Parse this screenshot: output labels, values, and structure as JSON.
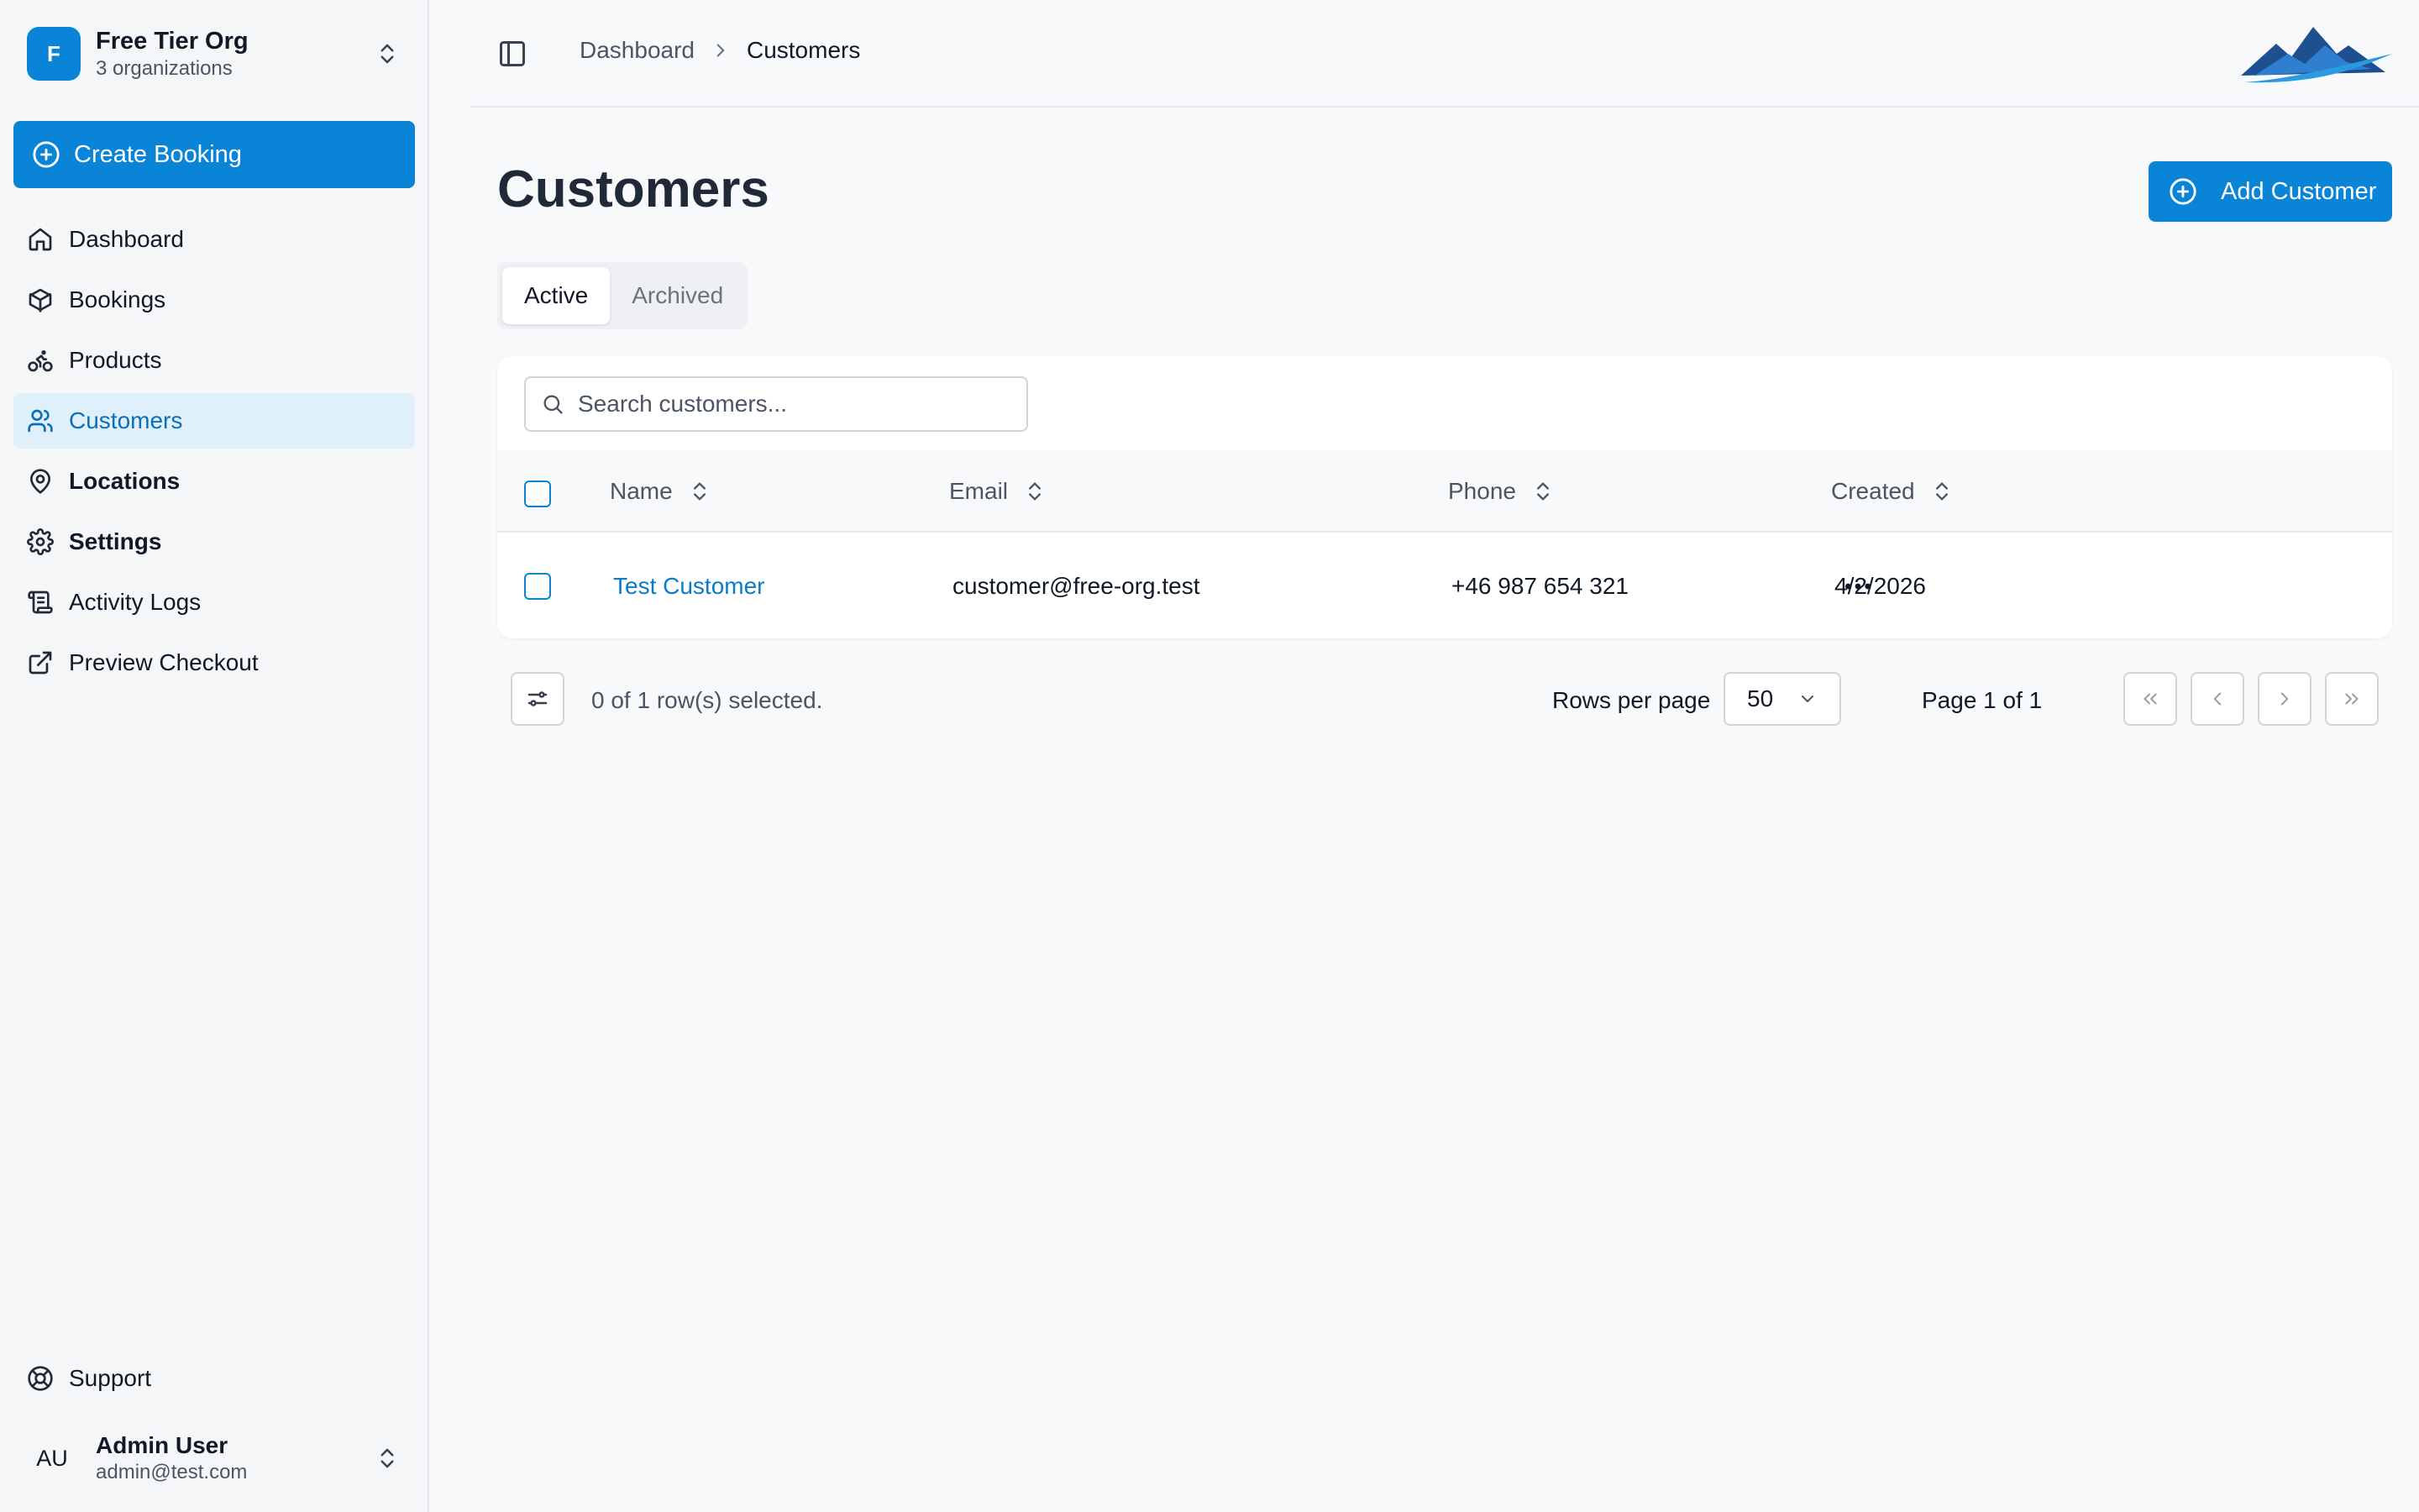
{
  "org": {
    "initial": "F",
    "name": "Free Tier Org",
    "subtitle": "3 organizations"
  },
  "sidebar": {
    "create_label": "Create Booking",
    "items": [
      {
        "label": "Dashboard",
        "icon": "home-icon"
      },
      {
        "label": "Bookings",
        "icon": "box-icon"
      },
      {
        "label": "Products",
        "icon": "bike-icon"
      },
      {
        "label": "Customers",
        "icon": "users-icon",
        "active": true
      },
      {
        "label": "Locations",
        "icon": "map-pin-icon"
      },
      {
        "label": "Settings",
        "icon": "gear-icon"
      },
      {
        "label": "Activity Logs",
        "icon": "logs-icon"
      },
      {
        "label": "Preview Checkout",
        "icon": "external-link-icon"
      }
    ],
    "support_label": "Support"
  },
  "user": {
    "initials": "AU",
    "name": "Admin User",
    "email": "admin@test.com"
  },
  "header": {
    "breadcrumb": [
      "Dashboard",
      "Customers"
    ]
  },
  "page": {
    "title": "Customers",
    "add_label": "Add Customer",
    "tabs": [
      {
        "label": "Active",
        "active": true
      },
      {
        "label": "Archived",
        "active": false
      }
    ],
    "search_placeholder": "Search customers..."
  },
  "table": {
    "columns": [
      "Name",
      "Email",
      "Phone",
      "Created"
    ],
    "rows": [
      {
        "name": "Test Customer",
        "email": "customer@free-org.test",
        "phone": "+46 987 654 321",
        "created": "4/2/2026"
      }
    ]
  },
  "pagination": {
    "selected_text": "0 of 1 row(s) selected.",
    "rows_per_page_label": "Rows per page",
    "rows_per_page_value": "50",
    "page_info": "Page 1 of 1"
  },
  "colors": {
    "accent": "#0a84d6",
    "active_bg": "#e0f0fb",
    "link": "#0a7cc9"
  }
}
